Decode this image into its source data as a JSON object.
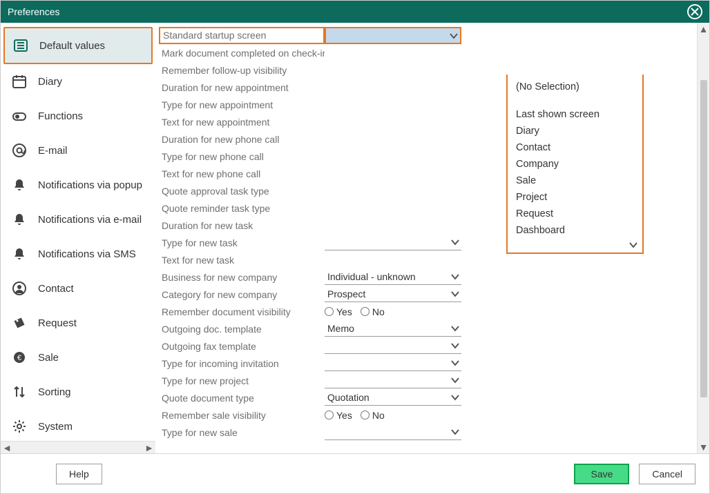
{
  "window": {
    "title": "Preferences"
  },
  "sidebar": {
    "items": [
      {
        "label": "Default values",
        "icon": "list-icon",
        "active": true
      },
      {
        "label": "Diary",
        "icon": "calendar-icon"
      },
      {
        "label": "Functions",
        "icon": "toggle-icon"
      },
      {
        "label": "E-mail",
        "icon": "at-icon"
      },
      {
        "label": "Notifications via popup",
        "icon": "bell-icon"
      },
      {
        "label": "Notifications via e-mail",
        "icon": "bell-icon"
      },
      {
        "label": "Notifications via SMS",
        "icon": "bell-icon"
      },
      {
        "label": "Contact",
        "icon": "user-icon"
      },
      {
        "label": "Request",
        "icon": "tag-icon"
      },
      {
        "label": "Sale",
        "icon": "money-icon"
      },
      {
        "label": "Sorting",
        "icon": "sort-icon"
      },
      {
        "label": "System",
        "icon": "gear-icon"
      }
    ]
  },
  "preferences": [
    {
      "label": "Standard startup screen",
      "control": "dropdown",
      "value": "",
      "highlighted": true,
      "open": true
    },
    {
      "label": "Mark document completed on check-in",
      "control": "none"
    },
    {
      "label": "Remember follow-up visibility",
      "control": "none"
    },
    {
      "label": "Duration for new appointment",
      "control": "none"
    },
    {
      "label": "Type for new appointment",
      "control": "none"
    },
    {
      "label": "Text for new appointment",
      "control": "none"
    },
    {
      "label": "Duration for new phone call",
      "control": "none"
    },
    {
      "label": "Type for new phone call",
      "control": "none"
    },
    {
      "label": "Text for new phone call",
      "control": "none"
    },
    {
      "label": "Quote approval task type",
      "control": "none"
    },
    {
      "label": "Quote reminder task type",
      "control": "none"
    },
    {
      "label": "Duration for new task",
      "control": "none"
    },
    {
      "label": "Type for new task",
      "control": "dropdown",
      "value": ""
    },
    {
      "label": "Text for new task",
      "control": "none"
    },
    {
      "label": "Business for new company",
      "control": "dropdown",
      "value": "Individual - unknown"
    },
    {
      "label": "Category for new company",
      "control": "dropdown",
      "value": "Prospect"
    },
    {
      "label": "Remember document visibility",
      "control": "radio",
      "options": [
        "Yes",
        "No"
      ]
    },
    {
      "label": "Outgoing doc. template",
      "control": "dropdown",
      "value": "Memo"
    },
    {
      "label": "Outgoing fax template",
      "control": "dropdown",
      "value": ""
    },
    {
      "label": "Type for incoming invitation",
      "control": "dropdown",
      "value": ""
    },
    {
      "label": "Type for new project",
      "control": "dropdown",
      "value": ""
    },
    {
      "label": "Quote document type",
      "control": "dropdown",
      "value": "Quotation"
    },
    {
      "label": "Remember sale visibility",
      "control": "radio",
      "options": [
        "Yes",
        "No"
      ]
    },
    {
      "label": "Type for new sale",
      "control": "dropdown",
      "value": ""
    }
  ],
  "dropdown": {
    "no_selection": "(No Selection)",
    "options": [
      "Last shown screen",
      "Diary",
      "Contact",
      "Company",
      "Sale",
      "Project",
      "Request",
      "Dashboard"
    ]
  },
  "footer": {
    "help": "Help",
    "save": "Save",
    "cancel": "Cancel"
  }
}
